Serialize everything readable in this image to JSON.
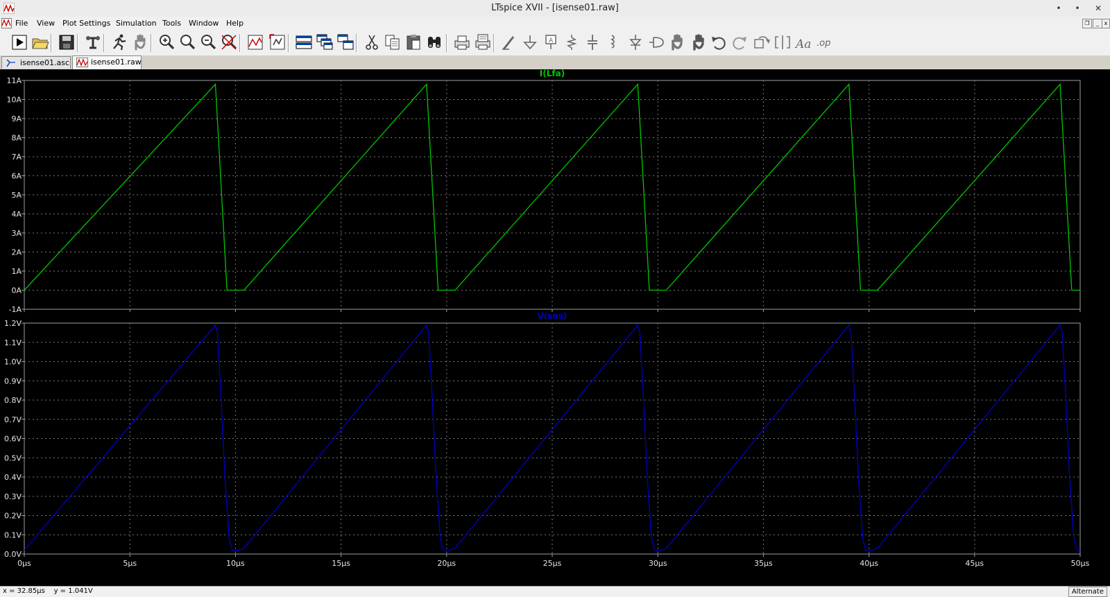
{
  "window": {
    "title": "LTspice XVII - [isense01.raw]",
    "controls": {
      "minimize": "•",
      "maximize": "•",
      "close": "✕"
    }
  },
  "menu": [
    {
      "label": "File"
    },
    {
      "label": "View"
    },
    {
      "label": "Plot Settings"
    },
    {
      "label": "Simulation"
    },
    {
      "label": "Tools"
    },
    {
      "label": "Window"
    },
    {
      "label": "Help"
    }
  ],
  "toolbar": {
    "buttons": [
      "run-icon",
      "open-icon",
      "save-icon",
      "control-panel-icon",
      "run-man-icon",
      "halt-hand-icon",
      "zoom-area-icon",
      "zoom-in-icon",
      "zoom-out-icon",
      "zoom-fit-icon",
      "autorange-icon",
      "pan-plot-icon",
      "tile-horizontal-icon",
      "cascade-icon",
      "tile-vertical-icon",
      "cut-icon",
      "copy-icon",
      "paste-icon",
      "find-icon",
      "print-icon",
      "print-preview-icon",
      "draw-wire-icon",
      "ground-icon",
      "label-net-icon",
      "resistor-icon",
      "capacitor-icon",
      "inductor-icon",
      "diode-icon",
      "component-icon",
      "move-icon",
      "drag-icon",
      "undo-icon",
      "redo-icon",
      "rotate-icon",
      "mirror-icon",
      "text-icon",
      "spice-directive-icon"
    ]
  },
  "tabs": [
    {
      "label": "isense01.asc",
      "icon": "schematic-icon",
      "active": false
    },
    {
      "label": "isense01.raw",
      "icon": "waveform-icon",
      "active": true
    }
  ],
  "chart_data": [
    {
      "type": "line",
      "title": "I(Lfa)",
      "color": "#00c800",
      "ylim": [
        -1,
        11
      ],
      "yticks": [
        -1,
        0,
        1,
        2,
        3,
        4,
        5,
        6,
        7,
        8,
        9,
        10,
        11
      ],
      "yticklabels": [
        "-1A",
        "0A",
        "1A",
        "2A",
        "3A",
        "4A",
        "5A",
        "6A",
        "7A",
        "8A",
        "9A",
        "10A",
        "11A"
      ],
      "xlim": [
        0,
        50
      ],
      "xticks": [
        0,
        5,
        10,
        15,
        20,
        25,
        30,
        35,
        40,
        45,
        50
      ],
      "xticklabels": [
        "0µs",
        "5µs",
        "10µs",
        "15µs",
        "20µs",
        "25µs",
        "30µs",
        "35µs",
        "40µs",
        "45µs",
        "50µs"
      ],
      "grid": true,
      "x": [
        0,
        9.05,
        9.6,
        9.9,
        10.05,
        10.4,
        19.05,
        19.6,
        19.9,
        20.05,
        20.4,
        29.05,
        29.6,
        29.9,
        30.05,
        30.4,
        39.05,
        39.6,
        39.9,
        40.05,
        40.4,
        49.05,
        49.6,
        49.9,
        50
      ],
      "y": [
        0,
        10.8,
        0,
        0,
        0,
        0,
        10.8,
        0,
        0,
        0,
        0,
        10.8,
        0,
        0,
        0,
        0,
        10.8,
        0,
        0,
        0,
        0,
        10.8,
        0,
        0,
        0
      ]
    },
    {
      "type": "line",
      "title": "V(sns)",
      "color": "#0000c8",
      "ylim": [
        0,
        1.2
      ],
      "yticks": [
        0,
        0.1,
        0.2,
        0.3,
        0.4,
        0.5,
        0.6,
        0.7,
        0.8,
        0.9,
        1.0,
        1.1,
        1.2
      ],
      "yticklabels": [
        "0.0V",
        "0.1V",
        "0.2V",
        "0.3V",
        "0.4V",
        "0.5V",
        "0.6V",
        "0.7V",
        "0.8V",
        "0.9V",
        "1.0V",
        "1.1V",
        "1.2V"
      ],
      "xlim": [
        0,
        50
      ],
      "xticks": [
        0,
        5,
        10,
        15,
        20,
        25,
        30,
        35,
        40,
        45,
        50
      ],
      "xticklabels": [
        "0µs",
        "5µs",
        "10µs",
        "15µs",
        "20µs",
        "25µs",
        "30µs",
        "35µs",
        "40µs",
        "45µs",
        "50µs"
      ],
      "grid": true,
      "x": [
        0,
        9.05,
        9.15,
        9.3,
        9.5,
        9.7,
        9.85,
        10.0,
        10.15,
        10.4,
        19.05,
        19.15,
        19.3,
        19.5,
        19.7,
        19.85,
        20.0,
        20.15,
        20.4,
        29.05,
        29.15,
        29.3,
        29.5,
        29.7,
        29.85,
        30.0,
        30.15,
        30.4,
        39.05,
        39.15,
        39.3,
        39.5,
        39.7,
        39.85,
        40.0,
        40.15,
        40.4,
        49.05,
        49.15,
        49.3,
        49.5,
        49.7,
        49.85,
        49.95,
        50
      ],
      "y": [
        0.02,
        1.19,
        1.15,
        0.85,
        0.4,
        0.08,
        0.02,
        0.015,
        0.02,
        0.03,
        1.19,
        1.15,
        0.85,
        0.4,
        0.08,
        0.02,
        0.015,
        0.02,
        0.03,
        1.19,
        1.15,
        0.85,
        0.4,
        0.08,
        0.02,
        0.015,
        0.02,
        0.03,
        1.19,
        1.15,
        0.85,
        0.4,
        0.08,
        0.02,
        0.015,
        0.02,
        0.03,
        1.19,
        1.15,
        0.85,
        0.4,
        0.08,
        0.02,
        0.015,
        0.02
      ]
    }
  ],
  "status": {
    "coords": "x = 32.85µs    y = 1.041V",
    "mode": "Alternate"
  }
}
